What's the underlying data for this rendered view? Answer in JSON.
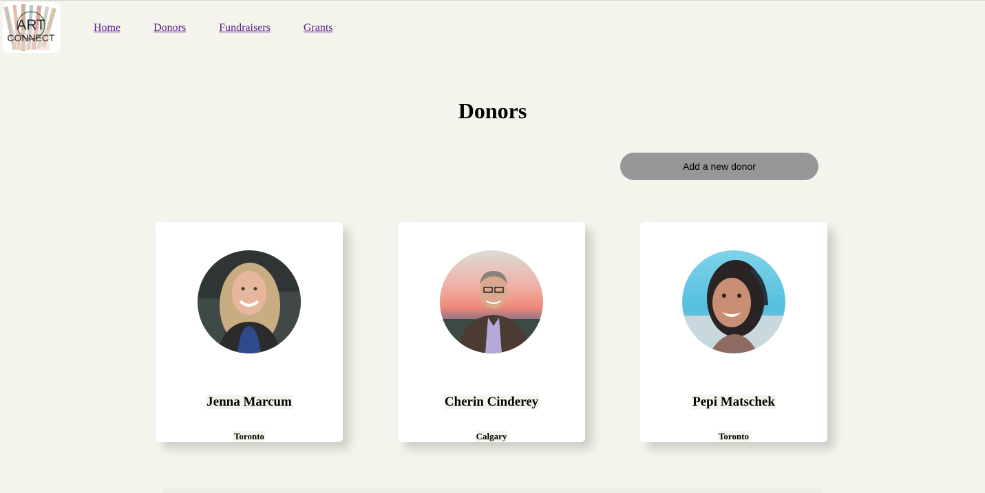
{
  "logo": {
    "line1": "ART",
    "line2": "CONNECT"
  },
  "nav": {
    "items": [
      {
        "label": "Home"
      },
      {
        "label": "Donors"
      },
      {
        "label": "Fundraisers"
      },
      {
        "label": "Grants"
      }
    ],
    "link_color": "#551a8b"
  },
  "page": {
    "title": "Donors",
    "background": "#f5f4ec"
  },
  "add_button": {
    "label": "Add a new donor",
    "color": "#979797"
  },
  "donors": [
    {
      "name": "Jenna Marcum",
      "city": "Toronto"
    },
    {
      "name": "Cherin Cinderey",
      "city": "Calgary"
    },
    {
      "name": "Pepi Matschek",
      "city": "Toronto"
    }
  ]
}
